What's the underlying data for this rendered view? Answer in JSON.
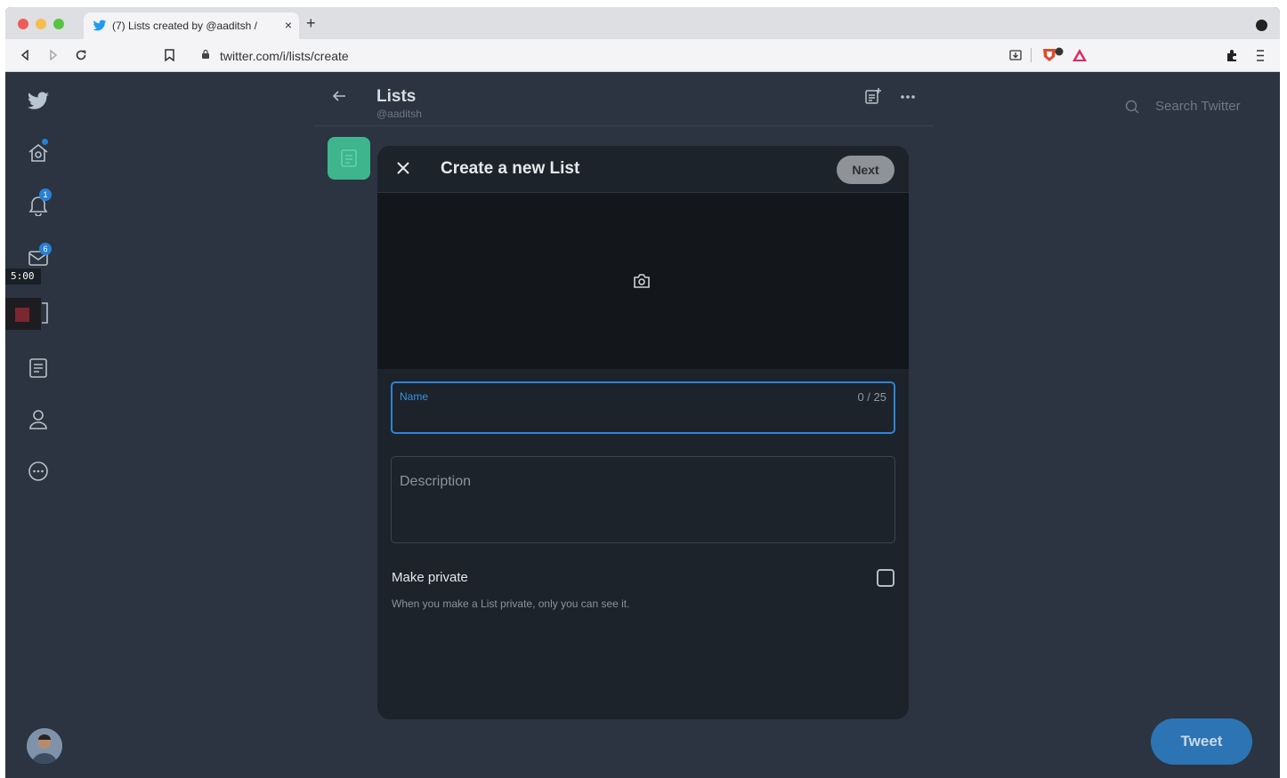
{
  "browser": {
    "tab_title": "(7) Lists created by @aaditsh /",
    "tab_close": "×",
    "new_tab": "+",
    "url": "twitter.com/i/lists/create"
  },
  "sidebar": {
    "notifications_badge": "1",
    "messages_badge": "6",
    "timer": "5:00"
  },
  "header": {
    "title": "Lists",
    "handle": "@aaditsh"
  },
  "search": {
    "placeholder": "Search Twitter"
  },
  "modal": {
    "title": "Create a new List",
    "next_label": "Next",
    "name_label": "Name",
    "name_value": "",
    "name_counter": "0 / 25",
    "description_label": "Description",
    "description_value": "",
    "private_label": "Make private",
    "private_hint": "When you make a List private, only you can see it.",
    "private_checked": false
  },
  "tweet_button": {
    "label": "Tweet"
  },
  "colors": {
    "background": "#2b3440",
    "modal": "#1d232b",
    "accent": "#2c84d6",
    "list_thumb": "#3fb58d"
  }
}
